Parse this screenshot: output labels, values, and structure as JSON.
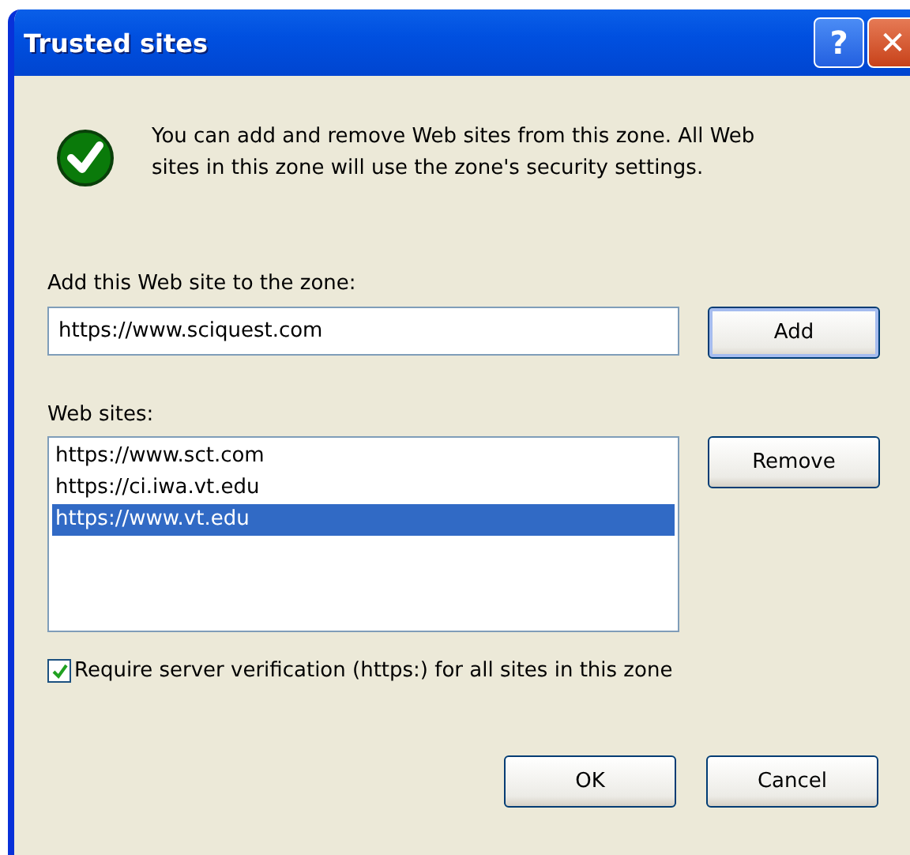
{
  "window": {
    "title": "Trusted sites",
    "title_buttons": [
      "?",
      "✕"
    ]
  },
  "message": "You can add and remove Web sites from this zone. All Web sites in this zone will use the zone's security settings.",
  "add_field": {
    "label": "Add this Web site to the zone:",
    "value": "https://www.sciquest.com"
  },
  "add_button": "Add",
  "sites": {
    "label": "Web sites:",
    "items": [
      {
        "text": "https://www.sct.com",
        "selected": false
      },
      {
        "text": "https://ci.iwa.vt.edu",
        "selected": false
      },
      {
        "text": "https://www.vt.edu",
        "selected": true
      }
    ]
  },
  "remove_button": "Remove",
  "require_https": {
    "label": "Require server verification (https:) for all sites in this zone",
    "checked": true
  },
  "buttons": [
    "OK",
    "Cancel"
  ]
}
